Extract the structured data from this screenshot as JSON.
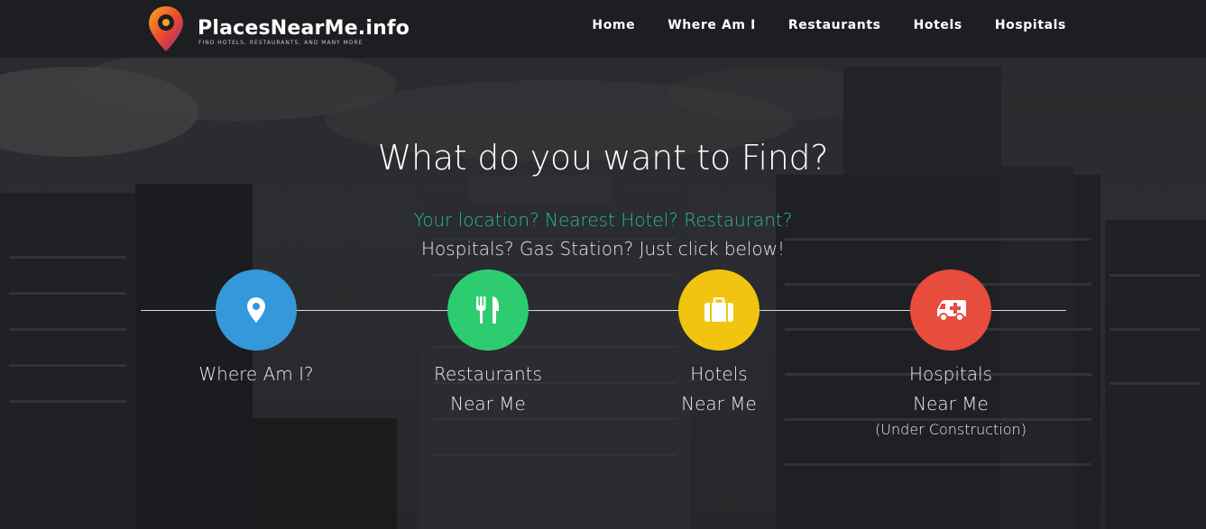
{
  "brand": {
    "name": "PlacesNearMe.info",
    "tagline": "FIND HOTELS, RESTAURANTS, AND MANY MORE"
  },
  "nav": {
    "items": [
      {
        "label": "Home"
      },
      {
        "label": "Where Am I"
      },
      {
        "label": "Restaurants"
      },
      {
        "label": "Hotels"
      },
      {
        "label": "Hospitals"
      }
    ]
  },
  "hero": {
    "title": "What do you want to Find?",
    "subtitle_line1": "Your location? Nearest Hotel? Restaurant?",
    "subtitle_line2": "Hospitals? Gas Station? Just click below!"
  },
  "options": [
    {
      "icon": "location-pin-icon",
      "color": "#3498db",
      "line1": "Where Am I?",
      "line2": "",
      "note": ""
    },
    {
      "icon": "fork-knife-icon",
      "color": "#2ecc71",
      "line1": "Restaurants",
      "line2": "Near Me",
      "note": ""
    },
    {
      "icon": "suitcase-icon",
      "color": "#f1c40f",
      "line1": "Hotels",
      "line2": "Near Me",
      "note": ""
    },
    {
      "icon": "ambulance-icon",
      "color": "#e74c3c",
      "line1": "Hospitals",
      "line2": "Near Me",
      "note": "(Under Construction)"
    }
  ],
  "colors": {
    "header_bg": "#1c1e21",
    "accent_teal": "#2bb89a"
  }
}
